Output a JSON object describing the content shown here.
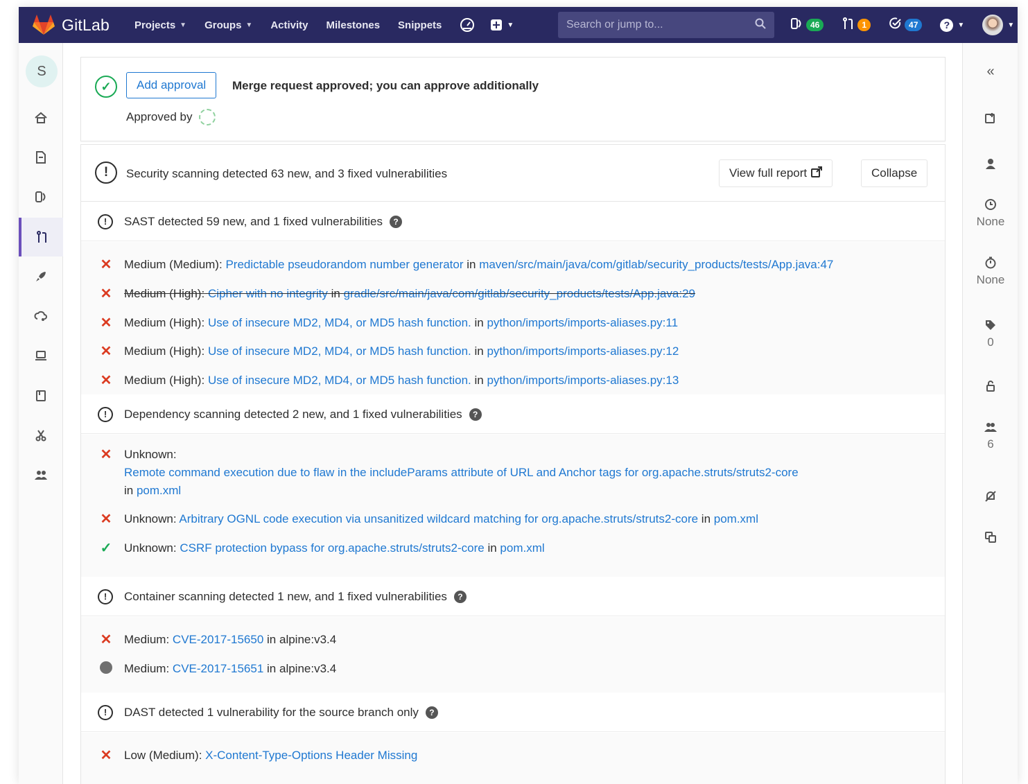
{
  "nav": {
    "brand": "GitLab",
    "links": [
      "Projects",
      "Groups",
      "Activity",
      "Milestones",
      "Snippets"
    ],
    "search_placeholder": "Search or jump to...",
    "issues_count": "46",
    "mr_count": "1",
    "todos_count": "47",
    "colors": {
      "navbar": "#292961",
      "issues_badge": "#1aaa55",
      "mr_badge": "#fc9403",
      "todos_badge": "#1f78d1"
    }
  },
  "sidebar": {
    "project_initial": "S"
  },
  "approval": {
    "button": "Add approval",
    "message": "Merge request approved; you can approve additionally",
    "approved_by": "Approved by"
  },
  "security": {
    "title": "Security scanning detected 63 new, and 3 fixed vulnerabilities",
    "view_report": "View full report",
    "collapse": "Collapse",
    "sast": {
      "title": "SAST detected 59 new, and 1 fixed vulnerabilities",
      "items": [
        {
          "severity": "Medium (Medium):",
          "name": "Predictable pseudorandom number generator",
          "in": "in",
          "path": "maven/src/main/java/com/gitlab/security_products/tests/App.java:47"
        },
        {
          "severity": "Medium (High):",
          "name": "Cipher with no integrity",
          "in": "in",
          "path": "gradle/src/main/java/com/gitlab/security_products/tests/App.java:29"
        },
        {
          "severity": "Medium (High):",
          "name": "Use of insecure MD2, MD4, or MD5 hash function.",
          "in": "in",
          "path": "python/imports/imports-aliases.py:11"
        },
        {
          "severity": "Medium (High):",
          "name": "Use of insecure MD2, MD4, or MD5 hash function.",
          "in": "in",
          "path": "python/imports/imports-aliases.py:12"
        },
        {
          "severity": "Medium (High):",
          "name": "Use of insecure MD2, MD4, or MD5 hash function.",
          "in": "in",
          "path": "python/imports/imports-aliases.py:13"
        }
      ]
    },
    "dependency": {
      "title": "Dependency scanning detected 2 new, and 1 fixed vulnerabilities",
      "items": [
        {
          "severity": "Unknown:",
          "name": "Remote command execution due to flaw in the includeParams attribute of URL and Anchor tags for org.apache.struts/struts2-core",
          "in": "in",
          "path": "pom.xml"
        },
        {
          "severity": "Unknown:",
          "name": "Arbitrary OGNL code execution via unsanitized wildcard matching for org.apache.struts/struts2-core",
          "in": "in",
          "path": "pom.xml"
        },
        {
          "severity": "Unknown:",
          "name": "CSRF protection bypass for org.apache.struts/struts2-core",
          "in": "in",
          "path": "pom.xml"
        }
      ]
    },
    "container": {
      "title": "Container scanning detected 1 new, and 1 fixed vulnerabilities",
      "items": [
        {
          "severity": "Medium:",
          "name": "CVE-2017-15650",
          "in": "in alpine:v3.4"
        },
        {
          "severity": "Medium:",
          "name": "CVE-2017-15651",
          "in": "in alpine:v3.4"
        }
      ]
    },
    "dast": {
      "title": "DAST detected 1 vulnerability for the source branch only",
      "items": [
        {
          "severity": "Low (Medium):",
          "name": "X-Content-Type-Options Header Missing"
        }
      ]
    }
  },
  "right_sidebar": {
    "milestone": "None",
    "time_tracking": "None",
    "labels": "0",
    "participants": "6"
  }
}
